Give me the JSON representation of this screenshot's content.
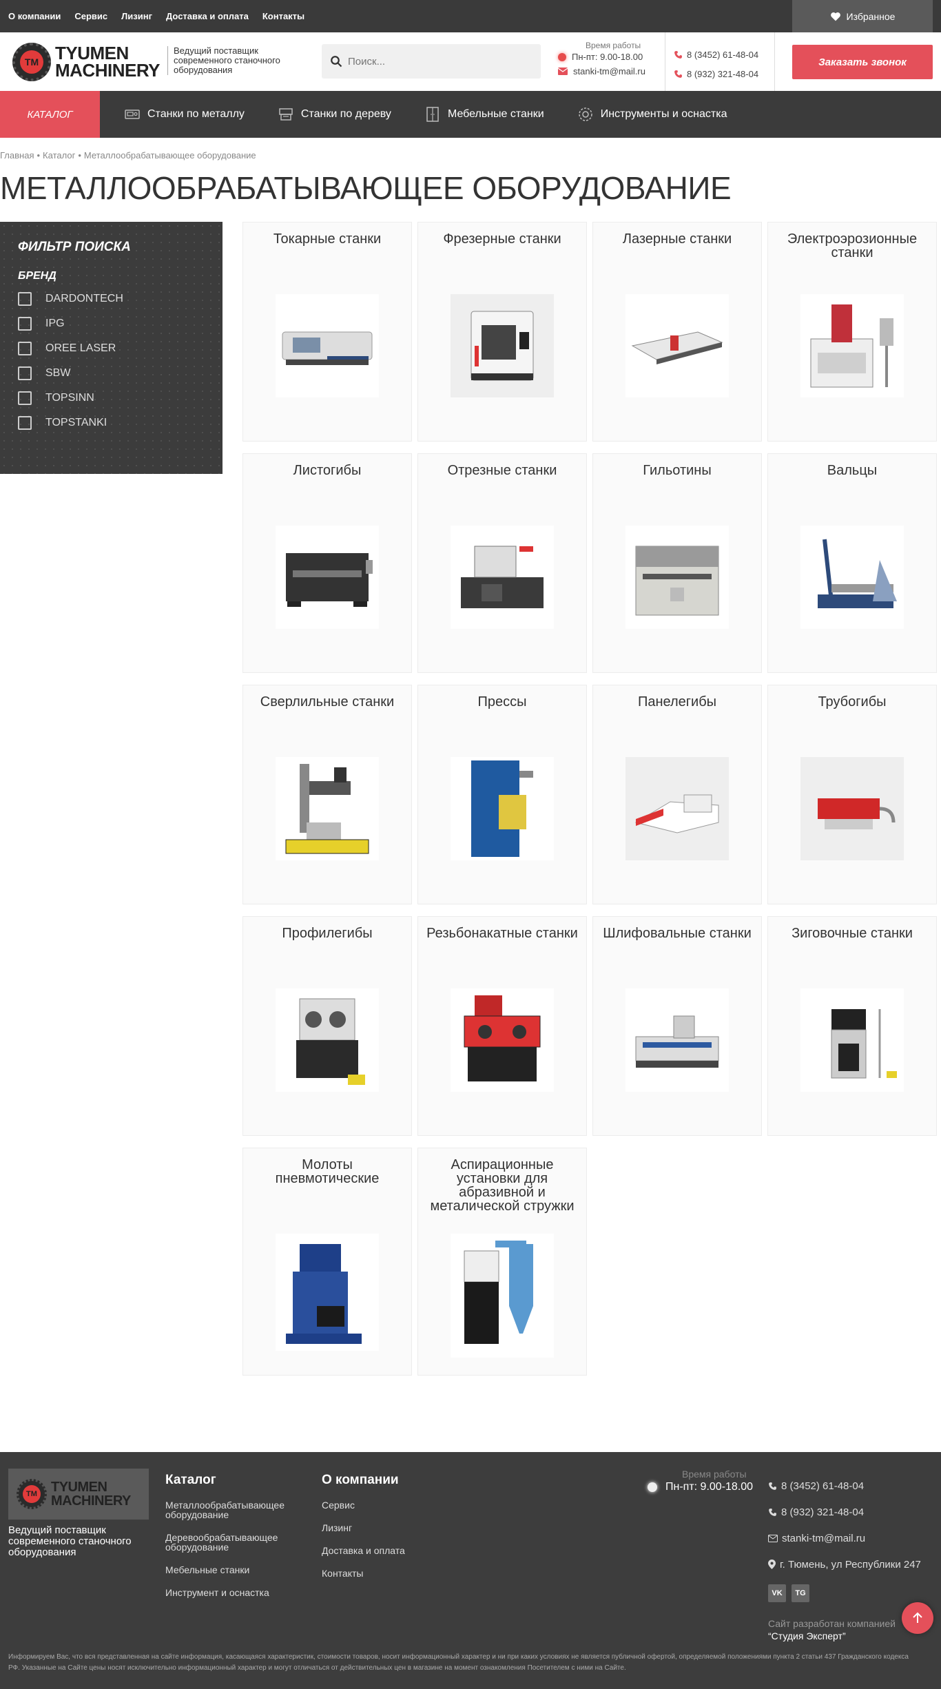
{
  "topnav": [
    "О компании",
    "Сервис",
    "Лизинг",
    "Доставка и оплата",
    "Контакты"
  ],
  "favorites_label": "Избранное",
  "logo": {
    "line1": "TYUMEN",
    "line2": "MACHINERY",
    "mark": "TM"
  },
  "tagline": "Ведущий поставщик современного станочного оборудования",
  "search_placeholder": "Поиск...",
  "worktime": {
    "label": "Время работы",
    "value": "Пн-пт: 9.00-18.00",
    "email": "stanki-tm@mail.ru"
  },
  "phones": [
    "8 (3452) 61-48-04",
    "8 (932) 321-48-04"
  ],
  "callback_label": "Заказать звонок",
  "catalog_label": "КАТАЛОГ",
  "mainnav": [
    {
      "label": "Станки по металлу",
      "icon": "metal-machine-icon"
    },
    {
      "label": "Станки по дереву",
      "icon": "wood-machine-icon"
    },
    {
      "label": "Мебельные станки",
      "icon": "furniture-icon"
    },
    {
      "label": "Инструменты и оснастка",
      "icon": "tools-icon"
    }
  ],
  "breadcrumbs": [
    "Главная",
    "Каталог",
    "Металлообрабатывающее оборудование"
  ],
  "page_title": "МЕТАЛЛООБРАБАТЫВАЮЩЕЕ ОБОРУДОВАНИЕ",
  "filter": {
    "title": "ФИЛЬТР ПОИСКА",
    "brand_label": "БРЕНД",
    "brands": [
      "DARDONTECH",
      "IPG",
      "OREE LASER",
      "SBW",
      "TOPSINN",
      "TOPSTANKI"
    ]
  },
  "categories": [
    "Токарные станки",
    "Фрезерные станки",
    "Лазерные станки",
    "Электроэрозионные станки",
    "Листогибы",
    "Отрезные станки",
    "Гильотины",
    "Вальцы",
    "Сверлильные станки",
    "Прессы",
    "Панелегибы",
    "Трубогибы",
    "Профилегибы",
    "Резьбонакатные станки",
    "Шлифовальные станки",
    "Зиговочные станки",
    "Молоты пневмотические",
    "Аспирационные установки для абразивной и металической стружки"
  ],
  "footer": {
    "tagline": "Ведущий поставщик современного станочного оборудования",
    "catalog_title": "Каталог",
    "catalog_links": [
      "Металлообрабатывающее оборудование",
      "Деревообрабатывающее оборудование",
      "Мебельные станки",
      "Инструмент и оснастка"
    ],
    "company_title": "О компании",
    "company_links": [
      "Сервис",
      "Лизинг",
      "Доставка и оплата",
      "Контакты"
    ],
    "worktime_label": "Время работы",
    "worktime_value": "Пн-пт: 9.00-18.00",
    "phone1": "8 (3452) 61-48-04",
    "phone2": "8 (932) 321-48-04",
    "email": "stanki-tm@mail.ru",
    "address": "г. Тюмень, ул Республики 247",
    "social_vk": "VK",
    "social_tg": "TG",
    "dev_label": "Сайт разработан компанией",
    "dev_name": "“Студия Эксперт”",
    "disclaimer": "Информируем Вас, что вся представленная на сайте информация, касающаяся характеристик, стоимости товаров, носит информационный характер и ни при каких условиях не является публичной офертой, определяемой положениями пункта 2 статьи 437 Гражданского кодекса РФ. Указанные на Сайте цены носят исключительно информационный характер и могут отличаться от действительных цен в магазине на момент ознакомления Посетителем с ними на Сайте."
  }
}
